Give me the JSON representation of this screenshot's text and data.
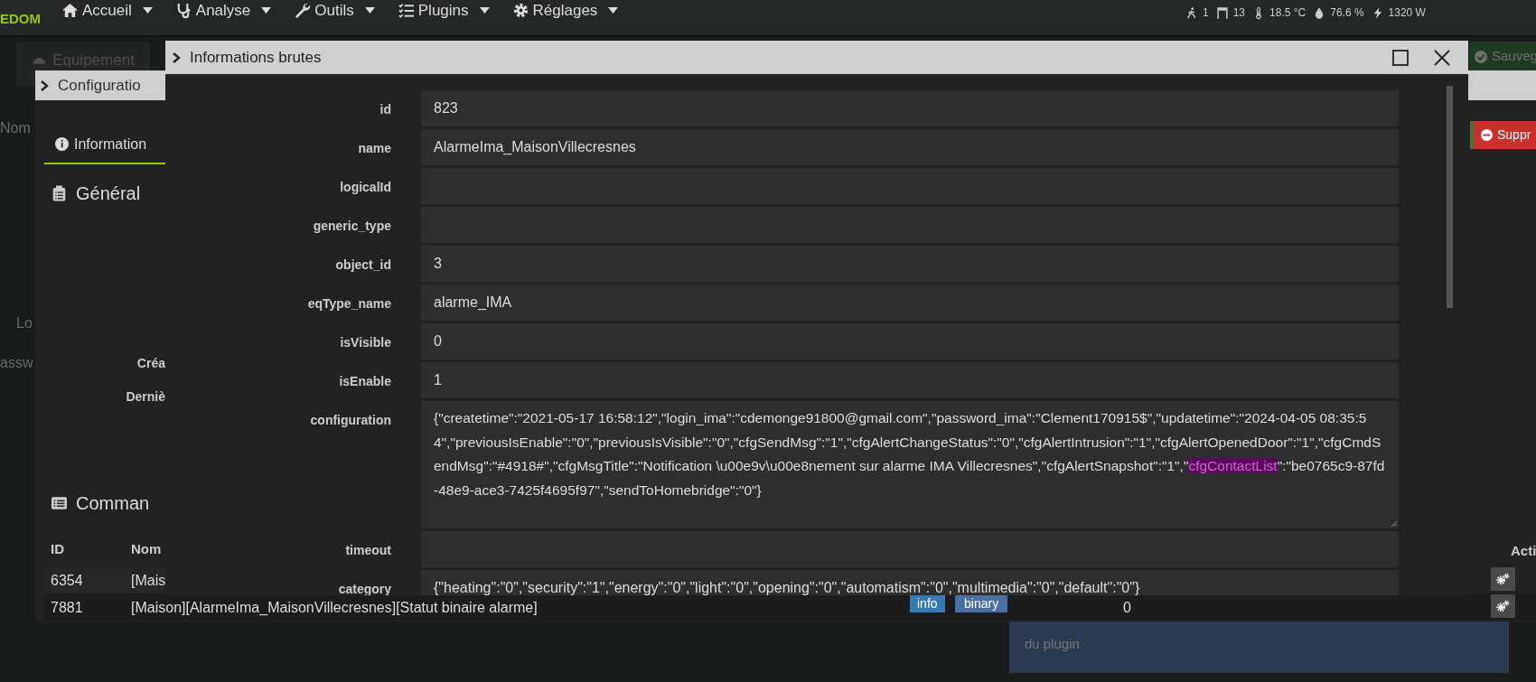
{
  "navbar": {
    "logo": "EDOM",
    "menu": [
      {
        "label": "Accueil"
      },
      {
        "label": "Analyse"
      },
      {
        "label": "Outils"
      },
      {
        "label": "Plugins"
      },
      {
        "label": "Réglages"
      }
    ],
    "status": [
      {
        "value": "1"
      },
      {
        "value": "13"
      },
      {
        "value": "18.5 °C"
      },
      {
        "value": "76.6 %"
      },
      {
        "value": "1320 W"
      }
    ]
  },
  "background": {
    "tab": "Equipement",
    "labels": [
      {
        "text": "Nom"
      },
      {
        "text": "Lo"
      },
      {
        "text": "assw"
      }
    ],
    "save_button": "Sauveg",
    "tooltip": "du plugin"
  },
  "config_modal": {
    "title": "Configuratio",
    "tab": {
      "label": "Information",
      "selected": true
    },
    "delete_button": "Suppr",
    "general_heading": "Général",
    "fields": [
      "Créa",
      "Derniè"
    ],
    "commands_heading": "Comman",
    "table": {
      "columns": [
        "ID",
        "Nom"
      ],
      "actions_column": "Acti",
      "rows": [
        {
          "id": "6354",
          "name": "[Mais"
        },
        {
          "id": "7881",
          "name": "[Maison][AlarmeIma_MaisonVillecresnes][Statut binaire alarme]",
          "type": "info",
          "subtype": "binary",
          "value": "0"
        }
      ]
    }
  },
  "raw_modal": {
    "title": "Informations brutes",
    "fields": [
      {
        "kind": "input",
        "label": "id",
        "value": "823"
      },
      {
        "kind": "input",
        "label": "name",
        "value": "AlarmeIma_MaisonVillecresnes"
      },
      {
        "kind": "input",
        "label": "logicalId"
      },
      {
        "kind": "input",
        "label": "generic_type"
      },
      {
        "kind": "input",
        "label": "object_id",
        "value": "3"
      },
      {
        "kind": "input",
        "label": "eqType_name",
        "value": "alarme_IMA"
      },
      {
        "kind": "input",
        "label": "isVisible",
        "value": "0"
      },
      {
        "kind": "input",
        "label": "isEnable",
        "value": "1"
      },
      {
        "kind": "textarea",
        "label": "configuration",
        "segments": [
          {
            "text": "{\"createtime\":\"2021-05-17 16:58:12\",\"login_ima\":\"cdemonge91800@gmail.com\",\"password_ima\":\"Clement170915$\",\"updatetime\":\"2024-04-05 08:35:54\",\"previousIsEnable\":\"0\",\"previousIsVisible\":\"0\",\"cfgSendMsg\":\"1\",\"cfgAlertChangeStatus\":\"0\",\"cfgAlertIntrusion\":\"1\",\"cfgAlertOpenedDoor\":\"1\",\"cfgCmdSendMsg\":\"#4918#\",\"cfgMsgTitle\":\"Notification \\u00e9v\\u00e8nement sur alarme IMA Villecresnes\",\"cfgAlertSnapshot\":\"1\",\"",
            "highlighted": false
          },
          {
            "text": "cfgContactList",
            "highlighted": true
          },
          {
            "text": "\":\"be0765c9-87fd-48e9-ace3-7425f4695f97\",\"sendToHomebridge\":\"0\"}",
            "highlighted": false
          }
        ]
      },
      {
        "kind": "input",
        "label": "timeout"
      },
      {
        "kind": "input",
        "label": "category",
        "value": "{\"heating\":\"0\",\"security\":\"1\",\"energy\":\"0\",\"light\":\"0\",\"opening\":\"0\",\"automatism\":\"0\",\"multimedia\":\"0\",\"default\":\"0\"}"
      }
    ]
  }
}
